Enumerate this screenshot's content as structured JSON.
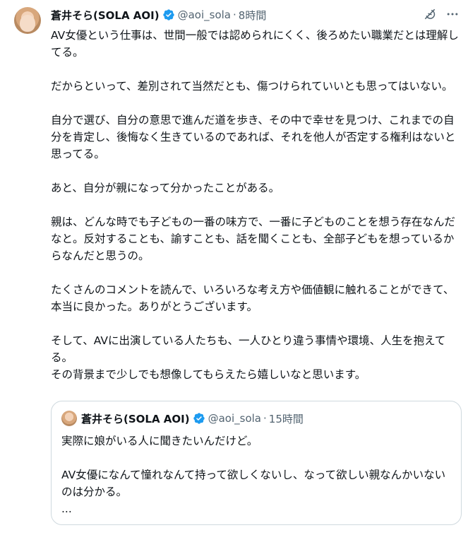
{
  "tweet": {
    "author": {
      "display_name": "蒼井そら(SOLA AOI)",
      "handle": "@aoi_sola",
      "separator": "·",
      "time": "8時間"
    },
    "paragraphs": [
      "AV女優という仕事は、世間一般では認められにくく、後ろめたい職業だとは理解してる。",
      "だからといって、差別されて当然だとも、傷つけられていいとも思ってはいない。",
      "自分で選び、自分の意思で進んだ道を歩き、その中で幸せを見つけ、これまでの自分を肯定し、後悔なく生きているのであれば、それを他人が否定する権利はないと思ってる。",
      "あと、自分が親になって分かったことがある。",
      "親は、どんな時でも子どもの一番の味方で、一番に子どものことを想う存在なんだなと。反対することも、諭すことも、話を聞くことも、全部子どもを想っているからなんだと思うの。",
      "たくさんのコメントを読んで、いろいろな考え方や価値観に触れることができて、本当に良かった。ありがとうございます。",
      "そして、AVに出演している人たちも、一人ひとり違う事情や環境、人生を抱えてる。",
      "その背景まで少しでも想像してもらえたら嬉しいなと思います。"
    ],
    "icons": {
      "grok": "grok-icon",
      "more": "more-icon",
      "verified": "verified-badge-icon"
    },
    "colors": {
      "verified": "#1d9bf0",
      "secondary_text": "#536471",
      "border": "#cfd9de"
    }
  },
  "quoted": {
    "author": {
      "display_name": "蒼井そら(SOLA AOI)",
      "handle": "@aoi_sola",
      "separator": "·",
      "time": "15時間"
    },
    "paragraphs": [
      "実際に娘がいる人に聞きたいんだけど。",
      "AV女優になんて憧れなんて持って欲しくないし、なって欲しい親なんかいないのは分かる。",
      "..."
    ]
  }
}
